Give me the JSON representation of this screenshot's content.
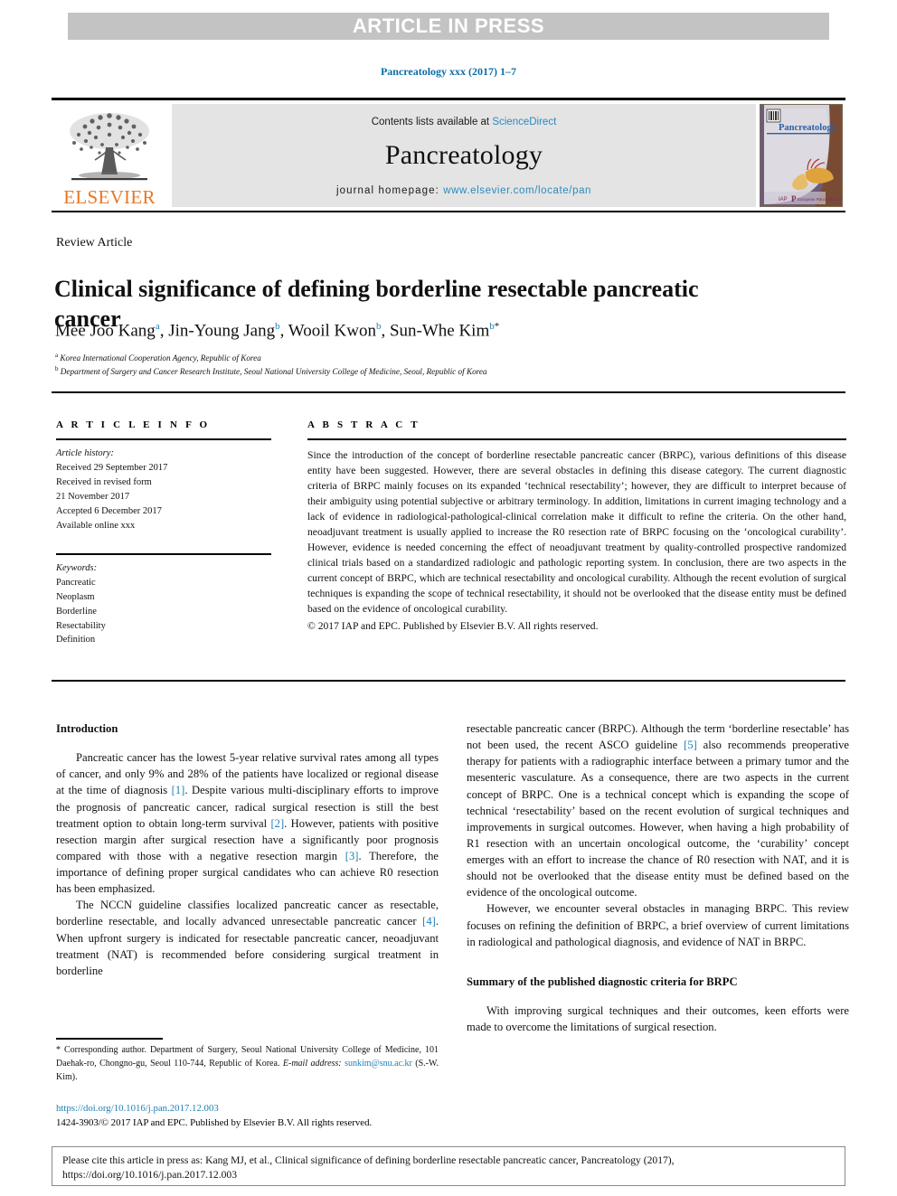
{
  "banner": {
    "label": "ARTICLE IN PRESS"
  },
  "running_head": {
    "text": "Pancreatology xxx (2017) 1–7"
  },
  "masthead": {
    "publisher": "ELSEVIER",
    "contents_prefix": "Contents lists available at ",
    "contents_link": "ScienceDirect",
    "journal_title": "Pancreatology",
    "homepage_prefix": "journal homepage: ",
    "homepage_url": "www.elsevier.com/locate/pan",
    "cover_title": "Pancreatology"
  },
  "article": {
    "type_label": "Review Article",
    "title": "Clinical significance of defining borderline resectable pancreatic cancer",
    "authors_html": "Mee Joo Kang , Jin-Young Jang , Wooil Kwon , Sun-Whe Kim",
    "author_list": [
      {
        "name": "Mee Joo Kang",
        "mark": "a"
      },
      {
        "name": "Jin-Young Jang",
        "mark": "b"
      },
      {
        "name": "Wooil Kwon",
        "mark": "b"
      },
      {
        "name": "Sun-Whe Kim",
        "mark": "b",
        "corresponding": "*"
      }
    ],
    "affiliations": [
      {
        "mark": "a",
        "text": "Korea International Cooperation Agency, Republic of Korea"
      },
      {
        "mark": "b",
        "text": "Department of Surgery and Cancer Research Institute, Seoul National University College of Medicine, Seoul, Republic of Korea"
      }
    ]
  },
  "article_info": {
    "heading": "A R T I C L E  I N F O",
    "history_label": "Article history:",
    "history": [
      "Received 29 September 2017",
      "Received in revised form",
      "21 November 2017",
      "Accepted 6 December 2017",
      "Available online xxx"
    ],
    "keywords_label": "Keywords:",
    "keywords": [
      "Pancreatic",
      "Neoplasm",
      "Borderline",
      "Resectability",
      "Definition"
    ]
  },
  "abstract": {
    "heading": "A B S T R A C T",
    "text": "Since the introduction of the concept of borderline resectable pancreatic cancer (BRPC), various definitions of this disease entity have been suggested. However, there are several obstacles in defining this disease category. The current diagnostic criteria of BRPC mainly focuses on its expanded ‘technical resectability’; however, they are difficult to interpret because of their ambiguity using potential subjective or arbitrary terminology. In addition, limitations in current imaging technology and a lack of evidence in radiological-pathological-clinical correlation make it difficult to refine the criteria. On the other hand, neoadjuvant treatment is usually applied to increase the R0 resection rate of BRPC focusing on the ‘oncological curability’. However, evidence is needed concerning the effect of neoadjuvant treatment by quality-controlled prospective randomized clinical trials based on a standardized radiologic and pathologic reporting system. In conclusion, there are two aspects in the current concept of BRPC, which are technical resectability and oncological curability. Although the recent evolution of surgical techniques is expanding the scope of technical resectability, it should not be overlooked that the disease entity must be defined based on the evidence of oncological curability.",
    "copyright": "© 2017 IAP and EPC. Published by Elsevier B.V. All rights reserved."
  },
  "body": {
    "left": {
      "heading": "Introduction",
      "paragraph_1_a": "Pancreatic cancer has the lowest 5-year relative survival rates among all types of cancer, and only 9% and 28% of the patients have localized or regional disease at the time of diagnosis ",
      "ref_1": "[1]",
      "paragraph_1_b": ". Despite various multi-disciplinary efforts to improve the prognosis of pancreatic cancer, radical surgical resection is still the best treatment option to obtain long-term survival ",
      "ref_2": "[2]",
      "paragraph_1_c": ". However, patients with positive resection margin after surgical resection have a significantly poor prognosis compared with those with a negative resection margin ",
      "ref_3": "[3]",
      "paragraph_1_d": ". Therefore, the importance of defining proper surgical candidates who can achieve R0 resection has been emphasized.",
      "paragraph_2_a": "The NCCN guideline classifies localized pancreatic cancer as resectable, borderline resectable, and locally advanced unresectable pancreatic cancer ",
      "ref_4": "[4]",
      "paragraph_2_b": ". When upfront surgery is indicated for resectable pancreatic cancer, neoadjuvant treatment (NAT) is recommended before considering surgical treatment in borderline"
    },
    "right": {
      "paragraph_1_a": "resectable pancreatic cancer (BRPC). Although the term ‘borderline resectable’ has not been used, the recent ASCO guideline ",
      "ref_5": "[5]",
      "paragraph_1_b": " also recommends preoperative therapy for patients with a radiographic interface between a primary tumor and the mesenteric vasculature. As a consequence, there are two aspects in the current concept of BRPC. One is a technical concept which is expanding the scope of technical ‘resectability’ based on the recent evolution of surgical techniques and improvements in surgical outcomes. However, when having a high probability of R1 resection with an uncertain oncological outcome, the ‘curability’ concept emerges with an effort to increase the chance of R0 resection with NAT, and it is should not be overlooked that the disease entity must be defined based on the evidence of the oncological outcome.",
      "paragraph_2": "However, we encounter several obstacles in managing BRPC. This review focuses on refining the definition of BRPC, a brief overview of current limitations in radiological and pathological diagnosis, and evidence of NAT in BRPC.",
      "heading_2": "Summary of the published diagnostic criteria for BRPC",
      "paragraph_3": "With improving surgical techniques and their outcomes, keen efforts were made to overcome the limitations of surgical resection."
    }
  },
  "footnote": {
    "corresponding_marker": "*",
    "corresponding_text": " Corresponding author. Department of Surgery, Seoul National University College of Medicine, 101 Daehak-ro, Chongno-gu, Seoul 110-744, Republic of Korea.",
    "email_label": "E-mail address:",
    "email": "sunkim@snu.ac.kr",
    "email_suffix": " (S.-W. Kim).",
    "doi": "https://doi.org/10.1016/j.pan.2017.12.003",
    "issn_line": "1424-3903/© 2017 IAP and EPC. Published by Elsevier B.V. All rights reserved."
  },
  "citation_box": {
    "text": "Please cite this article in press as: Kang MJ, et al., Clinical significance of defining borderline resectable pancreatic cancer, Pancreatology (2017), https://doi.org/10.1016/j.pan.2017.12.003"
  },
  "colors": {
    "link_blue": "#1e7fb5",
    "banner_gray": "#c3c3c3",
    "masthead_gray": "#e4e4e4",
    "elsevier_orange": "#e87722"
  }
}
